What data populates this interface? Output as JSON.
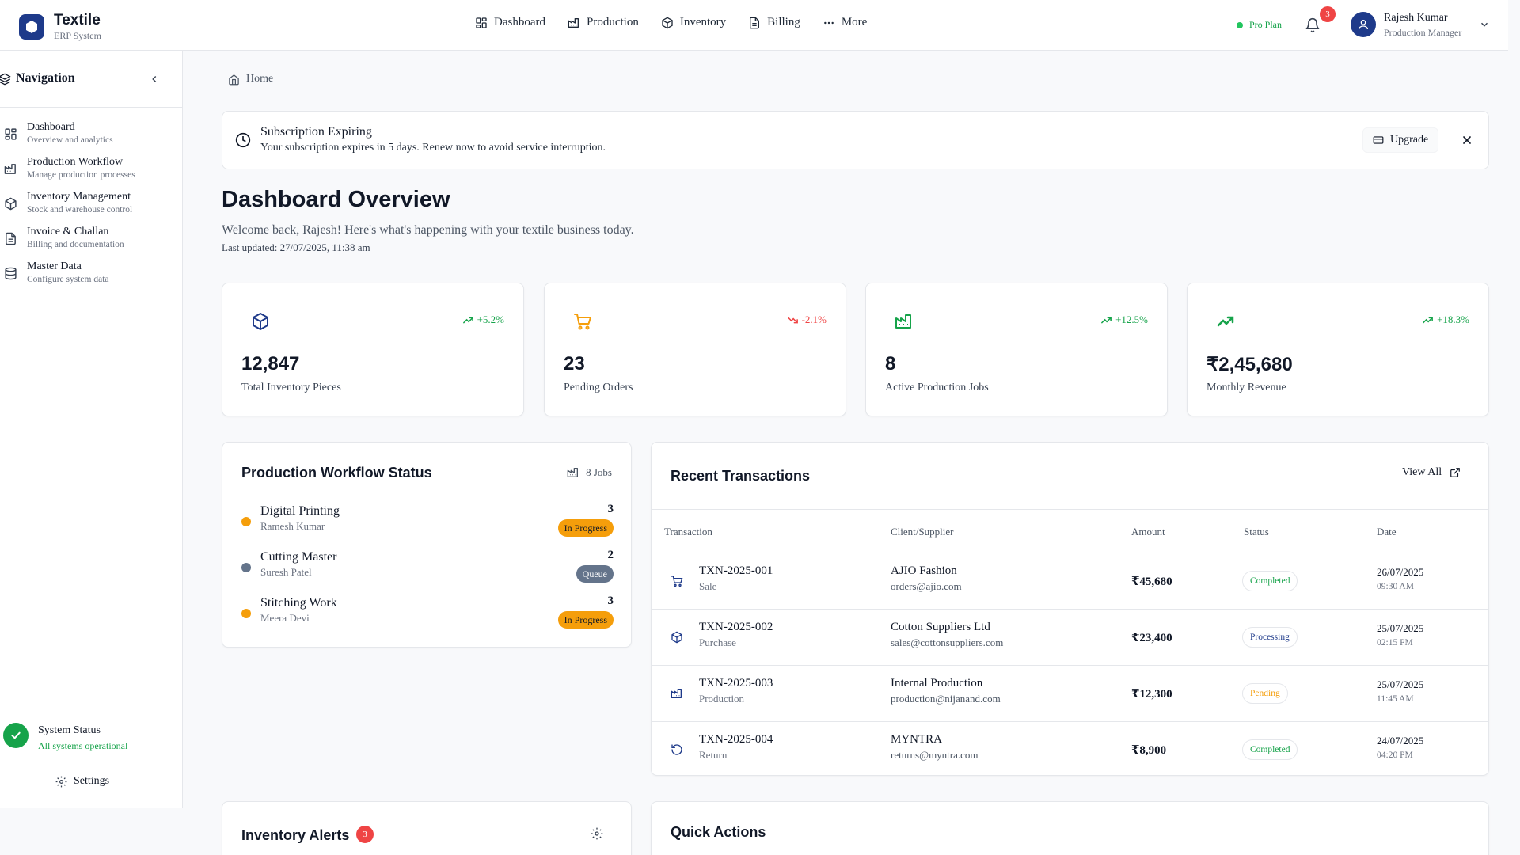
{
  "brand": {
    "title": "Textile",
    "subtitle": "ERP System"
  },
  "topnav": [
    {
      "label": "Dashboard",
      "icon": "grid-icon"
    },
    {
      "label": "Production",
      "icon": "factory-icon"
    },
    {
      "label": "Inventory",
      "icon": "package-icon"
    },
    {
      "label": "Billing",
      "icon": "file-icon"
    },
    {
      "label": "More",
      "icon": "more-icon"
    }
  ],
  "plan": {
    "label": "Pro Plan"
  },
  "notifications": {
    "count": "3"
  },
  "user": {
    "name": "Rajesh Kumar",
    "role": "Production Manager"
  },
  "sidebar": {
    "title": "Navigation",
    "items": [
      {
        "label": "Dashboard",
        "desc": "Overview and analytics"
      },
      {
        "label": "Production Workflow",
        "desc": "Manage production processes"
      },
      {
        "label": "Inventory Management",
        "desc": "Stock and warehouse control"
      },
      {
        "label": "Invoice & Challan",
        "desc": "Billing and documentation"
      },
      {
        "label": "Master Data",
        "desc": "Configure system data"
      }
    ],
    "status_title": "System Status",
    "status_sub": "All systems operational",
    "settings_label": "Settings"
  },
  "breadcrumb": {
    "home": "Home"
  },
  "alert": {
    "title": "Subscription Expiring",
    "desc": "Your subscription expires in 5 days. Renew now to avoid service interruption.",
    "upgrade_label": "Upgrade"
  },
  "page": {
    "title": "Dashboard Overview",
    "subtitle": "Welcome back, Rajesh! Here's what's happening with your textile business today.",
    "updated": "Last updated: 27/07/2025, 11:38 am"
  },
  "stats": [
    {
      "value": "12,847",
      "label": "Total Inventory Pieces",
      "change": "+5.2%",
      "trend": "up",
      "icon": "package-icon",
      "color": "#1e3a8a"
    },
    {
      "value": "23",
      "label": "Pending Orders",
      "change": "-2.1%",
      "trend": "down",
      "icon": "cart-icon",
      "color": "#f59e0b"
    },
    {
      "value": "8",
      "label": "Active Production Jobs",
      "change": "+12.5%",
      "trend": "up",
      "icon": "factory-icon",
      "color": "#16a34a"
    },
    {
      "value": "₹2,45,680",
      "label": "Monthly Revenue",
      "change": "+18.3%",
      "trend": "up",
      "icon": "trending-up-icon",
      "color": "#16a34a"
    }
  ],
  "workflow": {
    "title": "Production Workflow Status",
    "jobs_label": "8 Jobs",
    "items": [
      {
        "name": "Digital Printing",
        "person": "Ramesh Kumar",
        "count": "3",
        "status": "In Progress",
        "dot": "#f59e0b"
      },
      {
        "name": "Cutting Master",
        "person": "Suresh Patel",
        "count": "2",
        "status": "Queue",
        "dot": "#64748b"
      },
      {
        "name": "Stitching Work",
        "person": "Meera Devi",
        "count": "3",
        "status": "In Progress",
        "dot": "#f59e0b"
      }
    ]
  },
  "transactions": {
    "title": "Recent Transactions",
    "view_all": "View All",
    "columns": [
      "Transaction",
      "Client/Supplier",
      "Amount",
      "Status",
      "Date"
    ],
    "rows": [
      {
        "id": "TXN-2025-001",
        "type": "Sale",
        "client": "AJIO Fashion",
        "email": "orders@ajio.com",
        "amount": "₹45,680",
        "status": "Completed",
        "date": "26/07/2025",
        "time": "09:30 AM",
        "icon": "cart-icon"
      },
      {
        "id": "TXN-2025-002",
        "type": "Purchase",
        "client": "Cotton Suppliers Ltd",
        "email": "sales@cottonsuppliers.com",
        "amount": "₹23,400",
        "status": "Processing",
        "date": "25/07/2025",
        "time": "02:15 PM",
        "icon": "package-icon"
      },
      {
        "id": "TXN-2025-003",
        "type": "Production",
        "client": "Internal Production",
        "email": "production@nijanand.com",
        "amount": "₹12,300",
        "status": "Pending",
        "date": "25/07/2025",
        "time": "11:45 AM",
        "icon": "factory-icon"
      },
      {
        "id": "TXN-2025-004",
        "type": "Return",
        "client": "MYNTRA",
        "email": "returns@myntra.com",
        "amount": "₹8,900",
        "status": "Completed",
        "date": "24/07/2025",
        "time": "04:20 PM",
        "icon": "return-icon"
      }
    ]
  },
  "inventory_alerts": {
    "title": "Inventory Alerts",
    "count": "3"
  },
  "quick_actions": {
    "title": "Quick Actions"
  },
  "colors": {
    "brand": "#1e3a8a",
    "success": "#16a34a",
    "warning": "#f59e0b",
    "danger": "#ef4444"
  }
}
